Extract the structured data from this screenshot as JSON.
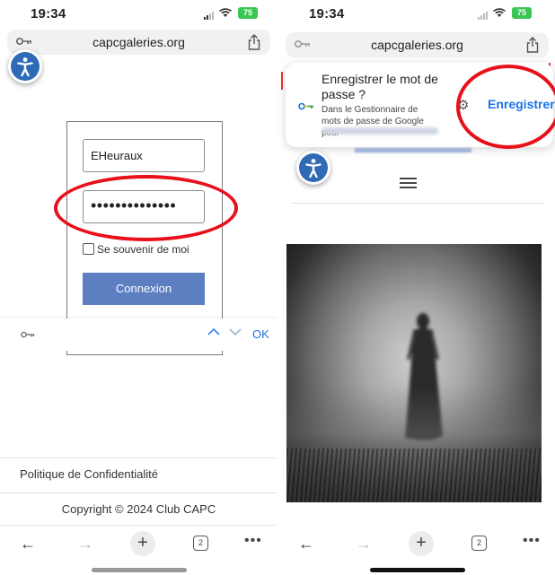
{
  "colors": {
    "annotation_red": "#e8101a",
    "accent_blue": "#1a73e8",
    "button_blue": "#5b7fc1",
    "a11y_blue": "#2f6bb5",
    "battery_green": "#39c653"
  },
  "left": {
    "status": {
      "time": "19:34",
      "battery": "75"
    },
    "url": "capcgaleries.org",
    "login": {
      "username": "EHeuraux",
      "password_mask": "••••••••••••••",
      "remember_label": "Se souvenir de moi",
      "submit_label": "Connexion"
    },
    "autofill": {
      "ok_label": "OK",
      "up_glyph": "^",
      "down_glyph": "v"
    },
    "footer": {
      "privacy_link": "Politique de Confidentialité",
      "copyright": "Copyright © 2024 Club CAPC"
    },
    "toolbar": {
      "back": "←",
      "forward": "→",
      "new_tab": "+",
      "tab_count": "2",
      "more": "•••"
    }
  },
  "right": {
    "status": {
      "time": "19:34",
      "battery": "75"
    },
    "url": "capcgaleries.org",
    "save_prompt": {
      "title": "Enregistrer le mot de passe ?",
      "description": "Dans le Gestionnaire de mots de passe de Google pour",
      "save_label": "Enregistrer"
    },
    "toolbar": {
      "back": "←",
      "forward": "→",
      "new_tab": "+",
      "tab_count": "2",
      "more": "•••"
    }
  }
}
